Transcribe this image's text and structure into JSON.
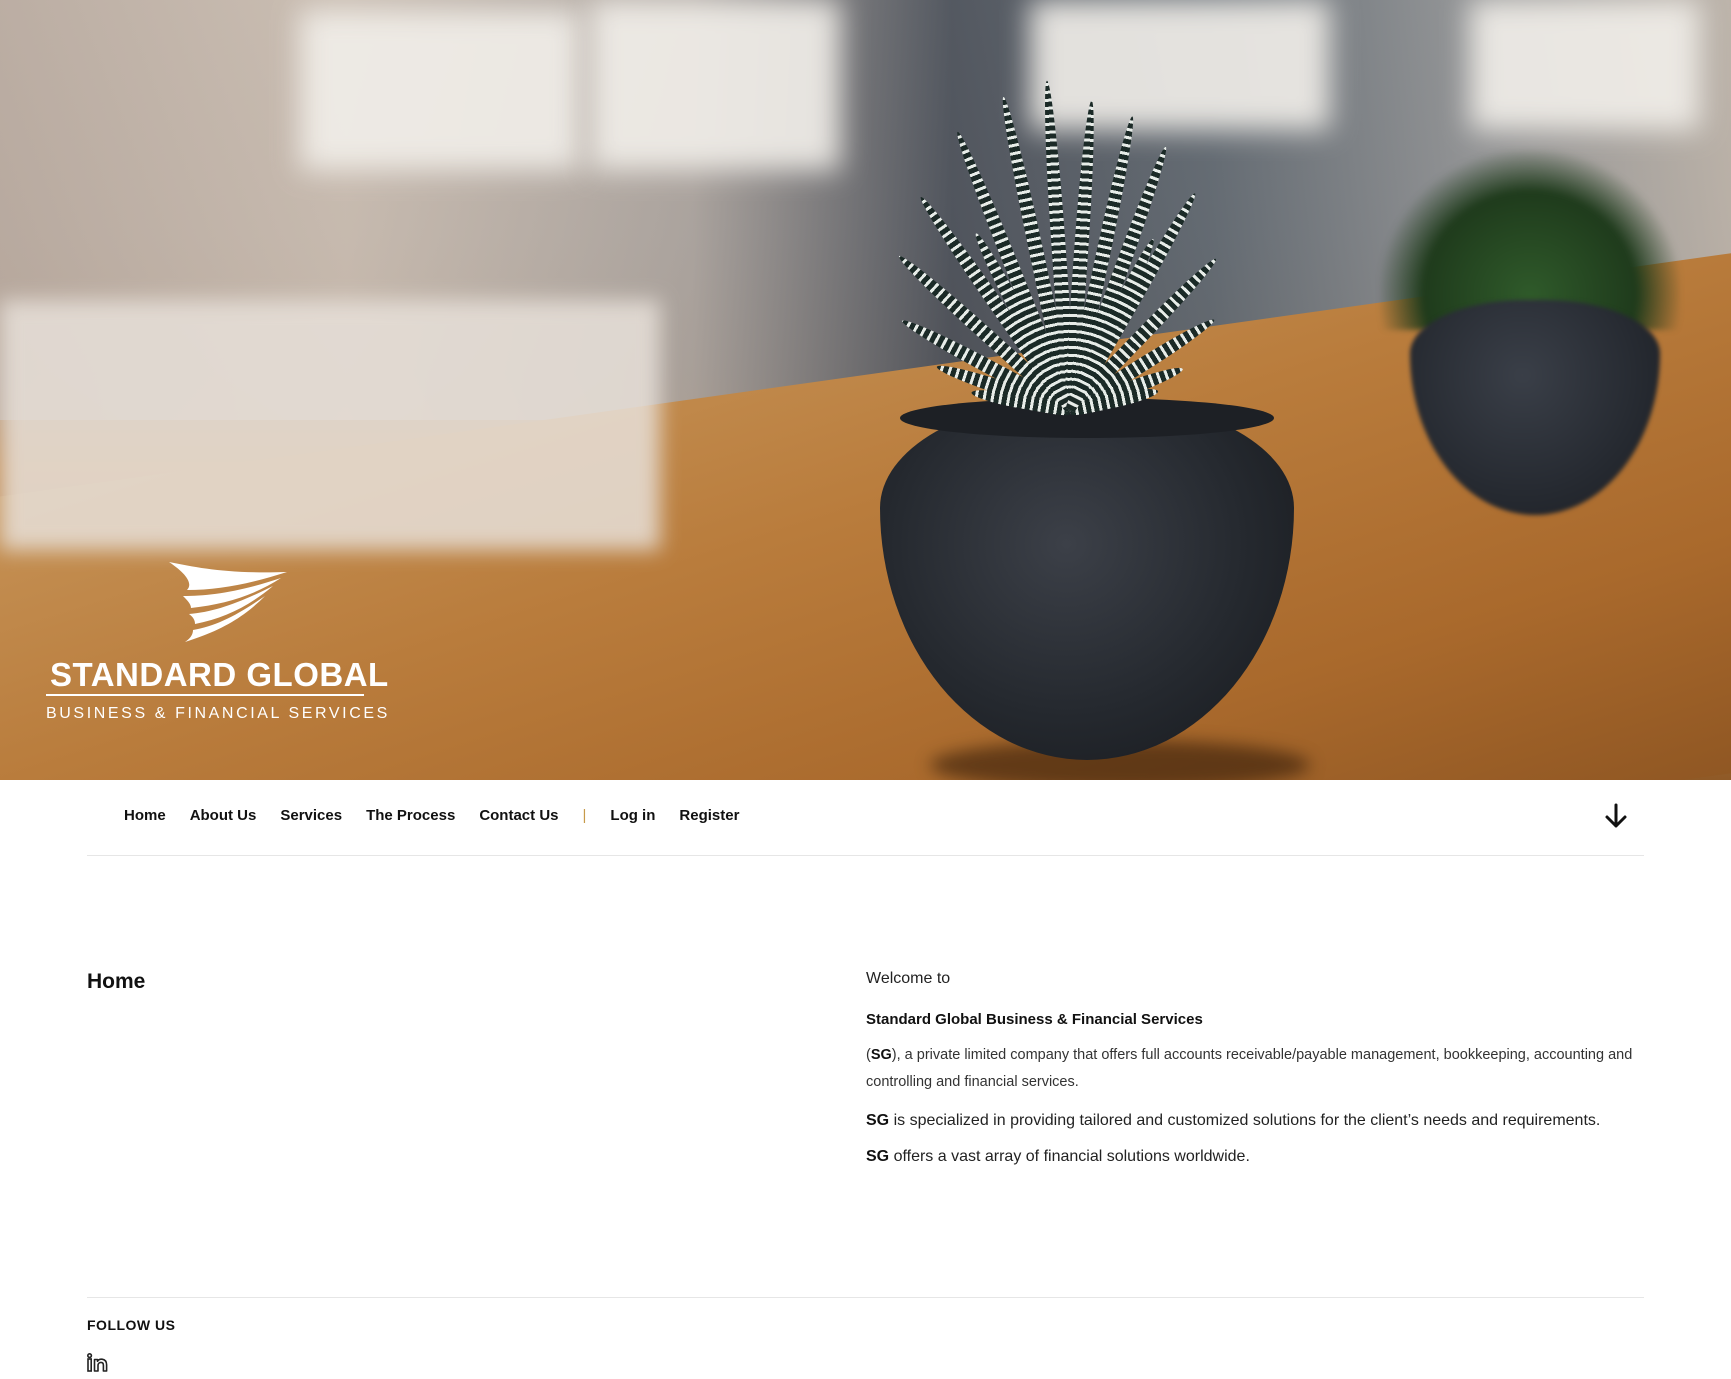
{
  "hero": {
    "logo": {
      "title": "STANDARD GLOBAL",
      "subtitle": "BUSINESS & FINANCIAL SERVICES",
      "mark_icon": "swoosh-wing-icon"
    }
  },
  "nav": {
    "items": [
      {
        "label": "Home"
      },
      {
        "label": "About Us"
      },
      {
        "label": "Services"
      },
      {
        "label": "The Process"
      },
      {
        "label": "Contact Us"
      }
    ],
    "separator": "|",
    "auth": [
      {
        "label": "Log in"
      },
      {
        "label": "Register"
      }
    ],
    "scroll_icon": "arrow-down-icon"
  },
  "main": {
    "page_title": "Home",
    "welcome": "Welcome to",
    "company_name": "Standard Global Business & Financial Services",
    "intro_open": "(",
    "intro_abbr": "SG",
    "intro_rest": "), a private limited company that offers full accounts receivable/payable management, bookkeeping, accounting and controlling and financial services.",
    "specialized_abbr": "SG",
    "specialized_text": " is specialized in providing tailored and customized solutions for the client’s needs and requirements.",
    "offers_abbr": "SG",
    "offers_text": " offers a vast array of financial solutions worldwide."
  },
  "footer": {
    "follow_label": "FOLLOW US",
    "social_icon": "linkedin-icon"
  },
  "colors": {
    "separator": "#c79a4a",
    "text": "#111111",
    "divider": "#e6e6e6"
  }
}
